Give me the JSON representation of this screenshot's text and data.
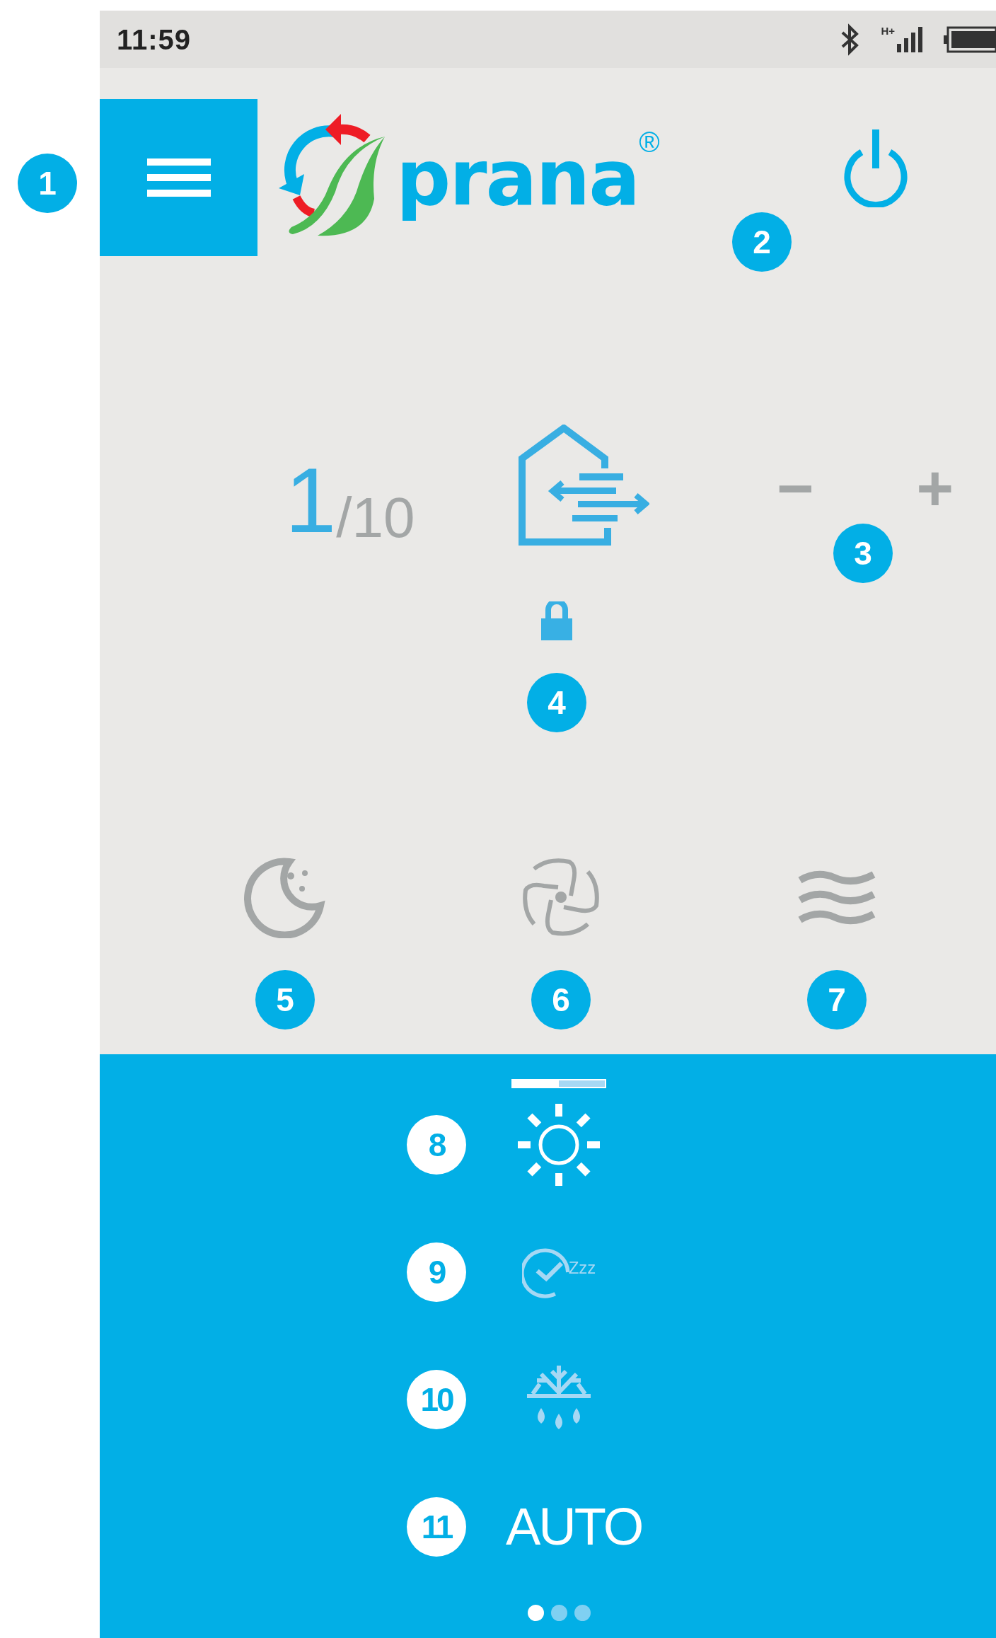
{
  "status_bar": {
    "time": "11:59",
    "network_type": "H+"
  },
  "header": {
    "menu_button": {
      "callout": "1"
    },
    "brand": "prana",
    "registered_mark": "®",
    "power_button": {
      "on": true,
      "callout": "2"
    }
  },
  "speed": {
    "current": "1",
    "max": "/10",
    "minus": "−",
    "plus": "+",
    "callout": "3"
  },
  "lock": {
    "locked": true,
    "callout": "4"
  },
  "modes": [
    {
      "kind": "night",
      "selected": false,
      "callout": "5"
    },
    {
      "kind": "fan",
      "selected": false,
      "callout": "6"
    },
    {
      "kind": "airflow",
      "selected": false,
      "callout": "7"
    }
  ],
  "panel": {
    "level": 0.5,
    "items": [
      {
        "kind": "sun",
        "active": true,
        "callout": "8"
      },
      {
        "kind": "sleep",
        "active": false,
        "label": "Zzz",
        "callout": "9"
      },
      {
        "kind": "defrost",
        "active": false,
        "callout": "10"
      },
      {
        "kind": "auto",
        "active": true,
        "label": "AUTO",
        "callout": "11"
      }
    ],
    "pager": [
      {
        "selected": true
      },
      {
        "selected": false
      },
      {
        "selected": false
      }
    ]
  }
}
